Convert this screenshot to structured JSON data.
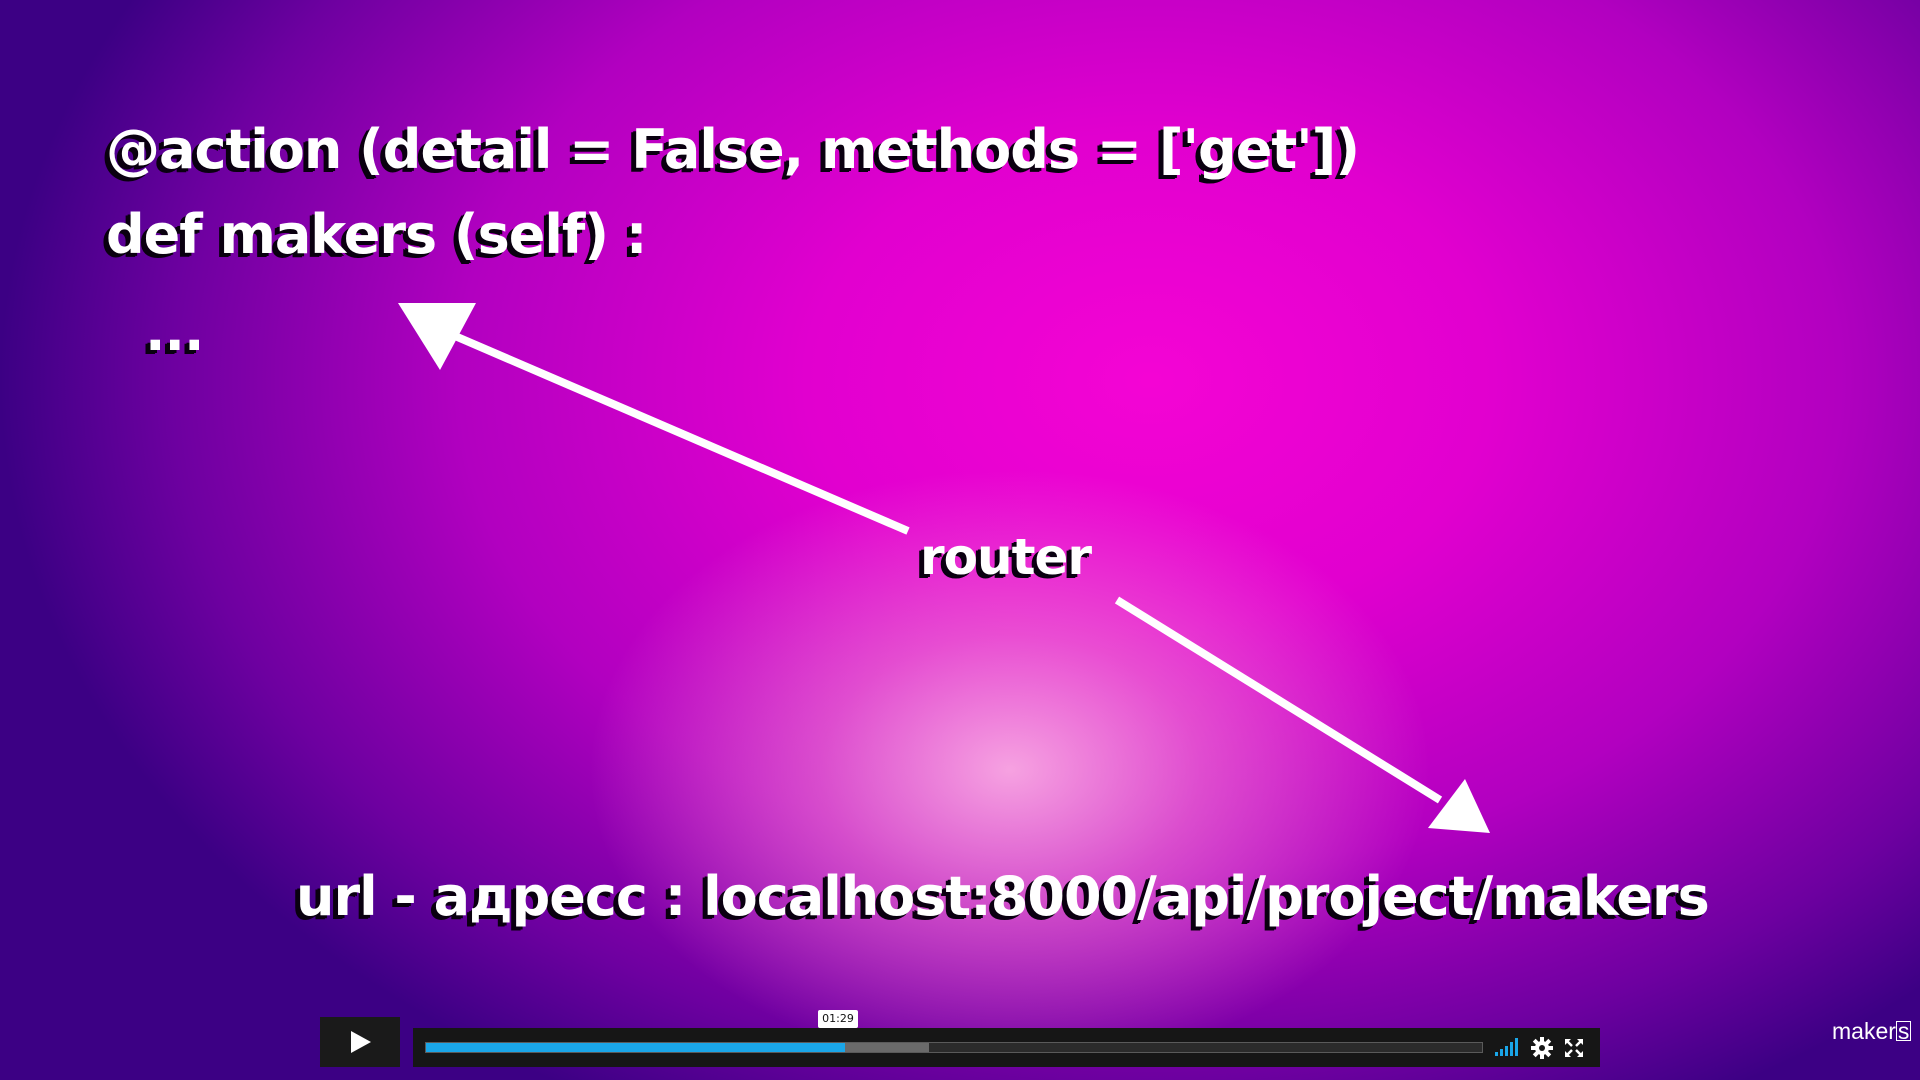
{
  "slide": {
    "code_line_1": "@action (detail = False, methods = ['get'])",
    "code_line_2": "def makers (self) :",
    "ellipsis": "...",
    "router_label": "router",
    "url_line": "url - адресс : localhost:8000/api/project/makers"
  },
  "player": {
    "progress_played": 0.397,
    "progress_loaded": 0.476,
    "time_tooltip": "01:29",
    "accent_color": "#1aa6e8",
    "icons": [
      "play-icon",
      "volume-icon",
      "settings-icon",
      "fullscreen-icon"
    ]
  },
  "watermark": {
    "text_main": "maker",
    "text_boxed": "s"
  }
}
